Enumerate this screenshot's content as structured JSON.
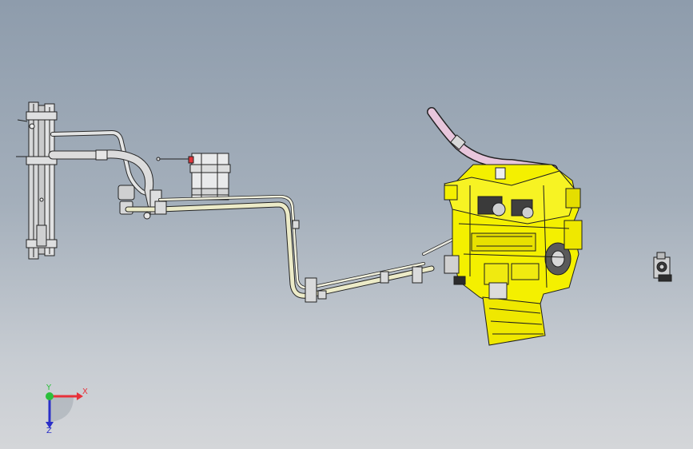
{
  "viewport": {
    "background_top": "#8e9cac",
    "background_bottom": "#d4d6d9"
  },
  "model": {
    "part_color": "#f4f000",
    "tube_color": "#ecebc8",
    "hose_color": "#e8c6dc",
    "edge_color": "#1f1f1f",
    "accent_color": "#e0353a"
  },
  "triad": {
    "x_label": "X",
    "y_label": "Y",
    "z_label": "Z",
    "x_color": "#e8313a",
    "y_color": "#2bbf3b",
    "z_color": "#2a2fc8"
  }
}
